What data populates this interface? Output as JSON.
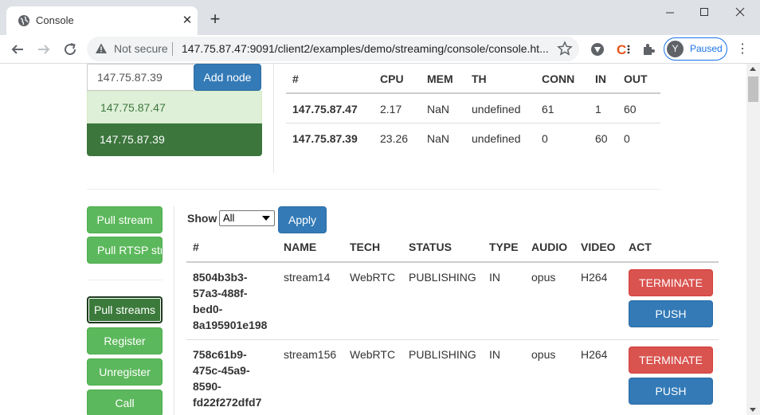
{
  "browser": {
    "tab_title": "Console",
    "new_tab_symbol": "+",
    "omnibox": {
      "security_text": "Not secure",
      "url": "147.75.87.47:9091/client2/examples/demo/streaming/console/console.ht..."
    },
    "profile": {
      "avatar_letter": "Y",
      "status": "Paused"
    }
  },
  "nodes": {
    "input_value": "147.75.87.39",
    "add_button": "Add node",
    "list": [
      {
        "address": "147.75.87.47",
        "active": false
      },
      {
        "address": "147.75.87.39",
        "active": true
      }
    ]
  },
  "node_table": {
    "columns": [
      "#",
      "CPU",
      "MEM",
      "TH",
      "CONN",
      "IN",
      "OUT"
    ],
    "rows": [
      {
        "id": "147.75.87.47",
        "cpu": "2.17",
        "mem": "NaN",
        "th": "undefined",
        "conn": "61",
        "in": "1",
        "out": "60"
      },
      {
        "id": "147.75.87.39",
        "cpu": "23.26",
        "mem": "NaN",
        "th": "undefined",
        "conn": "0",
        "in": "60",
        "out": "0"
      }
    ]
  },
  "sidebar": {
    "buttons": [
      "Pull stream",
      "Pull RTSP stream",
      "Pull streams",
      "Register",
      "Unregister",
      "Call"
    ]
  },
  "streams": {
    "show_label": "Show",
    "show_value": "All",
    "apply_button": "Apply",
    "columns": [
      "#",
      "NAME",
      "TECH",
      "STATUS",
      "TYPE",
      "AUDIO",
      "VIDEO",
      "ACT"
    ],
    "rows": [
      {
        "id_lines": [
          "8504b3b3-",
          "57a3-488f-",
          "bed0-",
          "8a195901e198"
        ],
        "name": "stream14",
        "tech": "WebRTC",
        "status": "PUBLISHING",
        "type": "IN",
        "audio": "opus",
        "video": "H264",
        "terminate": "TERMINATE",
        "push": "PUSH"
      },
      {
        "id_lines": [
          "758c61b9-",
          "475c-45a9-",
          "8590-",
          "fd22f272dfd7"
        ],
        "name": "stream156",
        "tech": "WebRTC",
        "status": "PUBLISHING",
        "type": "IN",
        "audio": "opus",
        "video": "H264",
        "terminate": "TERMINATE",
        "push": "PUSH"
      }
    ]
  },
  "colors": {
    "primary": "#337ab7",
    "success": "#5cb85c",
    "danger": "#d9534f",
    "node_active": "#3c763d",
    "node_inactive_bg": "#dff0d8"
  }
}
